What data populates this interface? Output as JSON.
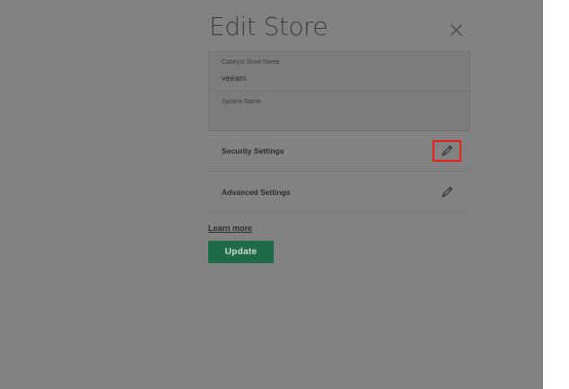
{
  "dialog": {
    "title": "Edit Store",
    "fields": [
      {
        "label": "Catalyst Store Name",
        "value": "veeam"
      },
      {
        "label": "System Name",
        "value": ""
      }
    ],
    "settings": [
      {
        "label": "Security Settings",
        "icon": "pencil-icon",
        "highlighted": true
      },
      {
        "label": "Advanced Settings",
        "icon": "pencil-icon",
        "highlighted": false
      }
    ],
    "learn_more": "Learn more",
    "update_label": "Update"
  },
  "colors": {
    "overlay": "#828282",
    "update_button": "#1e6b47",
    "highlight_box": "#e1241a"
  }
}
